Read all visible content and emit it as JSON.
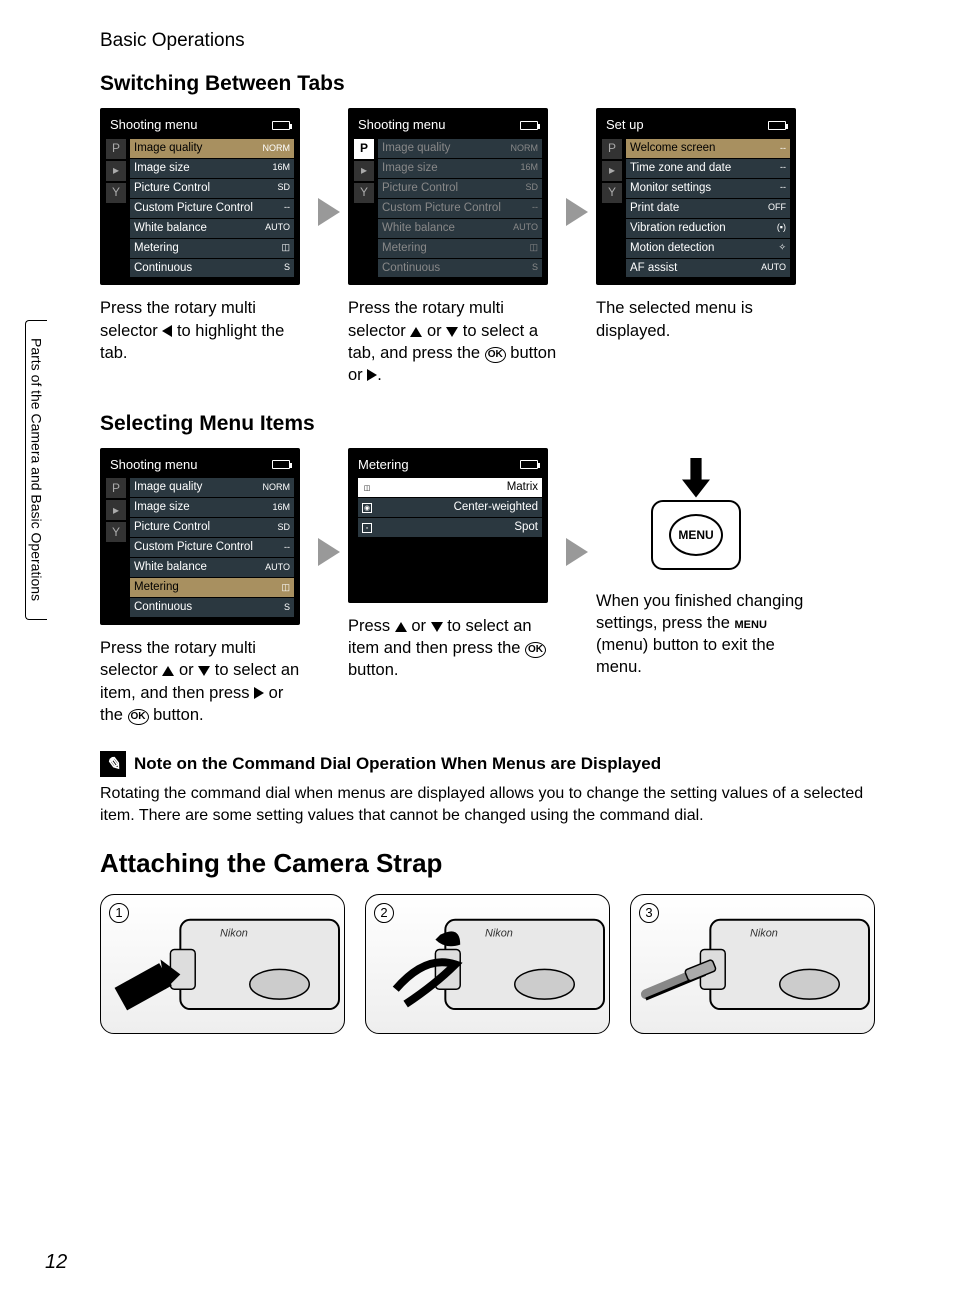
{
  "breadcrumb": "Basic Operations",
  "sideTab": "Parts of the Camera and Basic Operations",
  "pageNumber": "12",
  "sections": {
    "switching": {
      "title": "Switching Between Tabs",
      "menu1": {
        "title": "Shooting menu",
        "tabs": [
          "P",
          "▸",
          "Y"
        ],
        "rows": [
          {
            "label": "Image quality",
            "val": "NORM",
            "sel": true
          },
          {
            "label": "Image size",
            "val": "16M"
          },
          {
            "label": "Picture Control",
            "val": "SD"
          },
          {
            "label": "Custom Picture Control",
            "val": "--"
          },
          {
            "label": "White balance",
            "val": "AUTO"
          },
          {
            "label": "Metering",
            "val": "◫"
          },
          {
            "label": "Continuous",
            "val": "S"
          }
        ]
      },
      "caption1a": "Press the rotary multi selector ",
      "caption1b": " to highlight the tab.",
      "menu2": {
        "title": "Shooting menu",
        "tabs": [
          "P",
          "▸",
          "Y"
        ],
        "tabHighlight": 0,
        "rows": [
          {
            "label": "Image quality",
            "val": "NORM"
          },
          {
            "label": "Image size",
            "val": "16M"
          },
          {
            "label": "Picture Control",
            "val": "SD"
          },
          {
            "label": "Custom Picture Control",
            "val": "--"
          },
          {
            "label": "White balance",
            "val": "AUTO"
          },
          {
            "label": "Metering",
            "val": "◫"
          },
          {
            "label": "Continuous",
            "val": "S"
          }
        ]
      },
      "caption2a": "Press the rotary multi selector ",
      "caption2b": " or ",
      "caption2c": " to select a tab, and press the ",
      "caption2d": " button or ",
      "caption2e": ".",
      "menu3": {
        "title": "Set up",
        "tabs": [
          "P",
          "▸",
          "Y"
        ],
        "rows": [
          {
            "label": "Welcome screen",
            "val": "--",
            "sel": true
          },
          {
            "label": "Time zone and date",
            "val": "--"
          },
          {
            "label": "Monitor settings",
            "val": "--"
          },
          {
            "label": "Print date",
            "val": "OFF"
          },
          {
            "label": "Vibration reduction",
            "val": "(▪)"
          },
          {
            "label": "Motion detection",
            "val": "✧"
          },
          {
            "label": "AF assist",
            "val": "AUTO"
          }
        ]
      },
      "caption3": "The selected menu is displayed."
    },
    "selecting": {
      "title": "Selecting Menu Items",
      "menu1": {
        "title": "Shooting menu",
        "tabs": [
          "P",
          "▸",
          "Y"
        ],
        "rows": [
          {
            "label": "Image quality",
            "val": "NORM"
          },
          {
            "label": "Image size",
            "val": "16M"
          },
          {
            "label": "Picture Control",
            "val": "SD"
          },
          {
            "label": "Custom Picture Control",
            "val": "--"
          },
          {
            "label": "White balance",
            "val": "AUTO"
          },
          {
            "label": "Metering",
            "val": "◫",
            "sel": true
          },
          {
            "label": "Continuous",
            "val": "S"
          }
        ]
      },
      "caption1a": "Press the rotary multi selector ",
      "caption1b": " or ",
      "caption1c": " to select an item, and then press ",
      "caption1d": " or the ",
      "caption1e": " button.",
      "menu2": {
        "title": "Metering",
        "rows": [
          {
            "icon": "◫",
            "label": "Matrix",
            "sel": true
          },
          {
            "icon": "◉",
            "label": "Center-weighted"
          },
          {
            "icon": "▫",
            "label": "Spot"
          }
        ]
      },
      "caption2a": "Press ",
      "caption2b": " or ",
      "caption2c": " to select an item and then press the ",
      "caption2d": " button.",
      "menuButtonLabel": "MENU",
      "caption3a": "When you finished changing settings, press the ",
      "caption3b": " (menu) button to exit the menu."
    },
    "note": {
      "title": "Note on the Command Dial Operation When Menus are Displayed",
      "body": "Rotating the command dial when menus are displayed allows you to change the setting values of a selected item. There are some setting values that cannot be changed using the command dial."
    },
    "strap": {
      "title": "Attaching the Camera Strap",
      "steps": [
        "1",
        "2",
        "3"
      ]
    }
  },
  "okLabel": "OK",
  "menuWord": "MENU"
}
